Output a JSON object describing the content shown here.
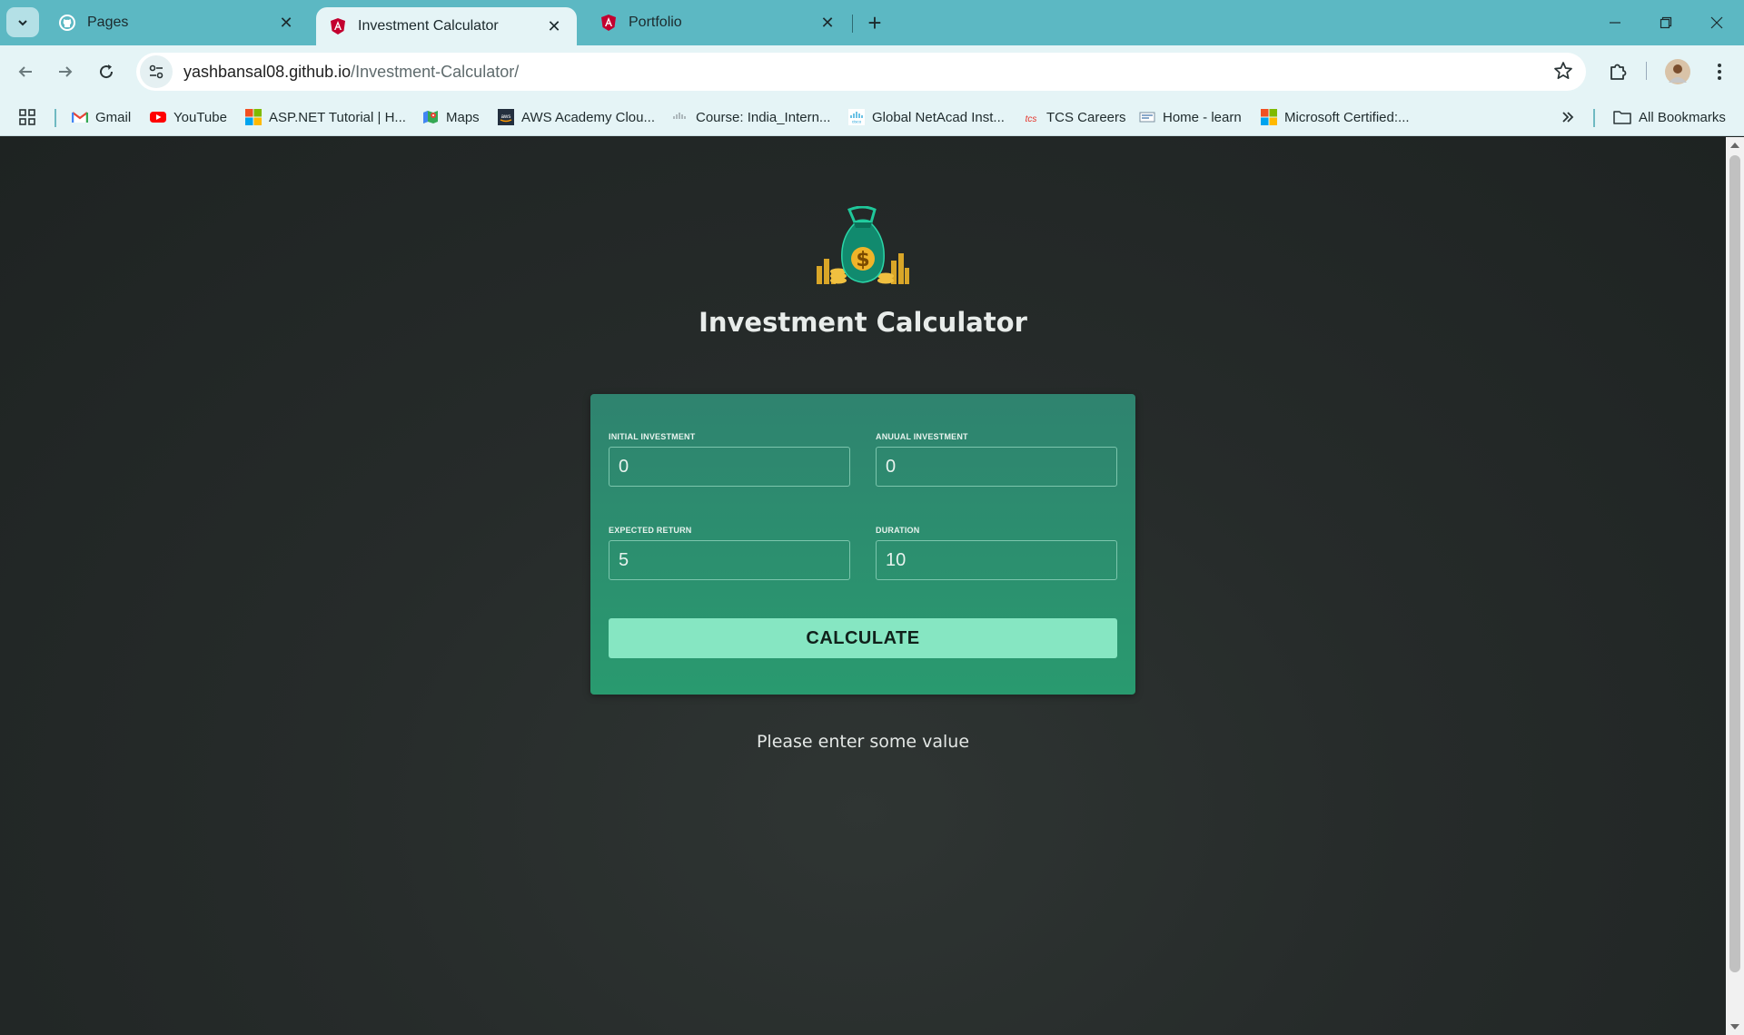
{
  "browser": {
    "tabs": [
      {
        "title": "Pages",
        "favicon": "github-icon",
        "active": false
      },
      {
        "title": "Investment Calculator",
        "favicon": "angular-icon",
        "active": true
      },
      {
        "title": "Portfolio",
        "favicon": "angular-icon",
        "active": false
      }
    ],
    "url_host": "yashbansal08.github.io",
    "url_path": "/Investment-Calculator/",
    "bookmarks": [
      {
        "label": "Gmail",
        "icon": "gmail-icon"
      },
      {
        "label": "YouTube",
        "icon": "youtube-icon"
      },
      {
        "label": "ASP.NET Tutorial | H...",
        "icon": "microsoft-icon"
      },
      {
        "label": "Maps",
        "icon": "maps-icon"
      },
      {
        "label": "AWS Academy Clou...",
        "icon": "aws-icon"
      },
      {
        "label": "Course: India_Intern...",
        "icon": "cisco-icon"
      },
      {
        "label": "Global NetAcad Inst...",
        "icon": "cisco-icon"
      },
      {
        "label": "TCS Careers",
        "icon": "tcs-icon"
      },
      {
        "label": "Home - learn",
        "icon": "learn-icon"
      },
      {
        "label": "Microsoft Certified:...",
        "icon": "microsoft-icon"
      }
    ],
    "all_bookmarks_label": "All Bookmarks"
  },
  "app": {
    "title": "Investment Calculator",
    "logo": "money-bag-logo",
    "fields": {
      "initial_investment": {
        "label": "INITIAL INVESTMENT",
        "value": "0"
      },
      "annual_investment": {
        "label": "ANUUAL INVESTMENT",
        "value": "0"
      },
      "expected_return": {
        "label": "EXPECTED RETURN",
        "value": "5"
      },
      "duration": {
        "label": "DURATION",
        "value": "10"
      }
    },
    "calculate_label": "CALCULATE",
    "message": "Please enter some value"
  },
  "colors": {
    "card": "#2b8f6f",
    "button": "#86e6c2",
    "tabstrip": "#5cb8c3",
    "background": "#262b2a"
  }
}
